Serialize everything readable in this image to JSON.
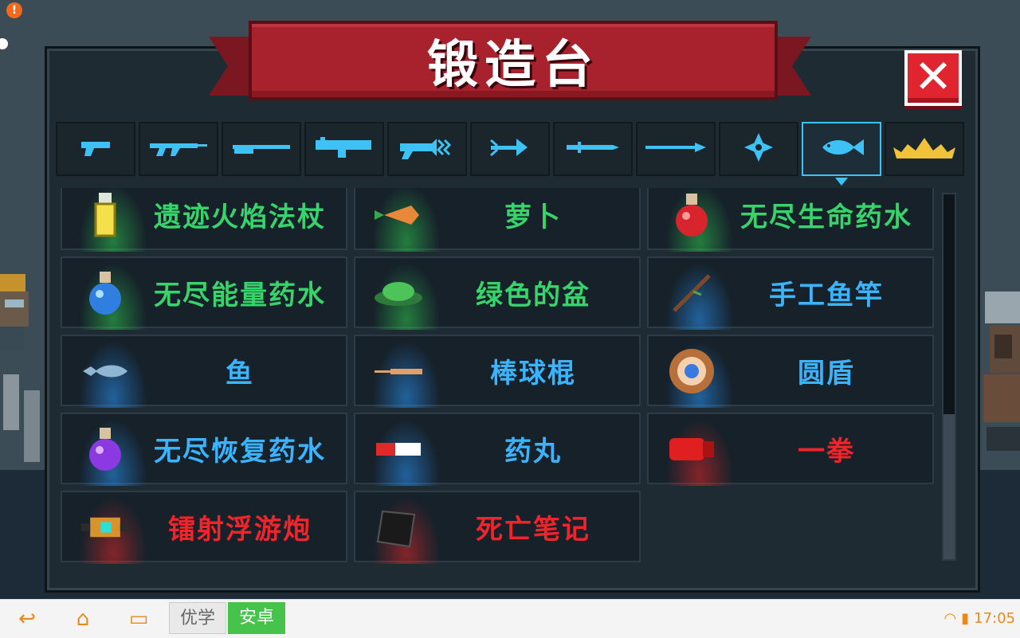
{
  "window": {
    "title": "锻造台",
    "close_icon": "close-icon"
  },
  "tabs": [
    {
      "name": "pistol",
      "icon": "pistol-icon",
      "selected": false
    },
    {
      "name": "rifle",
      "icon": "assault-rifle-icon",
      "selected": false
    },
    {
      "name": "shotgun",
      "icon": "shotgun-icon",
      "selected": false
    },
    {
      "name": "launcher",
      "icon": "rocket-launcher-icon",
      "selected": false
    },
    {
      "name": "laser",
      "icon": "laser-gun-icon",
      "selected": false
    },
    {
      "name": "bow",
      "icon": "bow-icon",
      "selected": false
    },
    {
      "name": "sword",
      "icon": "sword-icon",
      "selected": false
    },
    {
      "name": "spear",
      "icon": "spear-icon",
      "selected": false
    },
    {
      "name": "throwing",
      "icon": "shuriken-icon",
      "selected": false
    },
    {
      "name": "misc",
      "icon": "fish-icon",
      "selected": true
    },
    {
      "name": "special",
      "icon": "crown-icon",
      "selected": false
    }
  ],
  "items": [
    {
      "name": "遗迹火焰法杖",
      "rarity": "green",
      "icon": "lighter-staff-icon"
    },
    {
      "name": "萝卜",
      "rarity": "green",
      "icon": "carrot-icon"
    },
    {
      "name": "无尽生命药水",
      "rarity": "green",
      "icon": "red-potion-icon"
    },
    {
      "name": "无尽能量药水",
      "rarity": "green",
      "icon": "blue-potion-icon"
    },
    {
      "name": "绿色的盆",
      "rarity": "green",
      "icon": "green-pot-icon"
    },
    {
      "name": "手工鱼竿",
      "rarity": "blue",
      "icon": "fishing-rod-icon"
    },
    {
      "name": "鱼",
      "rarity": "blue",
      "icon": "fish-icon"
    },
    {
      "name": "棒球棍",
      "rarity": "blue",
      "icon": "baseball-bat-icon"
    },
    {
      "name": "圆盾",
      "rarity": "blue",
      "icon": "round-shield-icon"
    },
    {
      "name": "无尽恢复药水",
      "rarity": "blue",
      "icon": "purple-potion-icon"
    },
    {
      "name": "药丸",
      "rarity": "blue",
      "icon": "pill-icon"
    },
    {
      "name": "一拳",
      "rarity": "red",
      "icon": "red-glove-icon"
    },
    {
      "name": "镭射浮游炮",
      "rarity": "red",
      "icon": "laser-drone-icon"
    },
    {
      "name": "死亡笔记",
      "rarity": "red",
      "icon": "death-note-icon"
    }
  ],
  "scroll": {
    "position_fraction": 1.0
  },
  "colors": {
    "green": "#36d46a",
    "blue": "#3ab4ff",
    "red": "#f0242a",
    "accent": "#3ec2f5",
    "banner": "#a8222e"
  },
  "navbar": {
    "back_icon": "back-icon",
    "home_icon": "home-icon",
    "recents_icon": "recents-icon",
    "app_label_1": "优学",
    "app_label_2": "安卓",
    "time": "17:05",
    "wifi_icon": "wifi-icon",
    "battery_icon": "battery-icon"
  }
}
